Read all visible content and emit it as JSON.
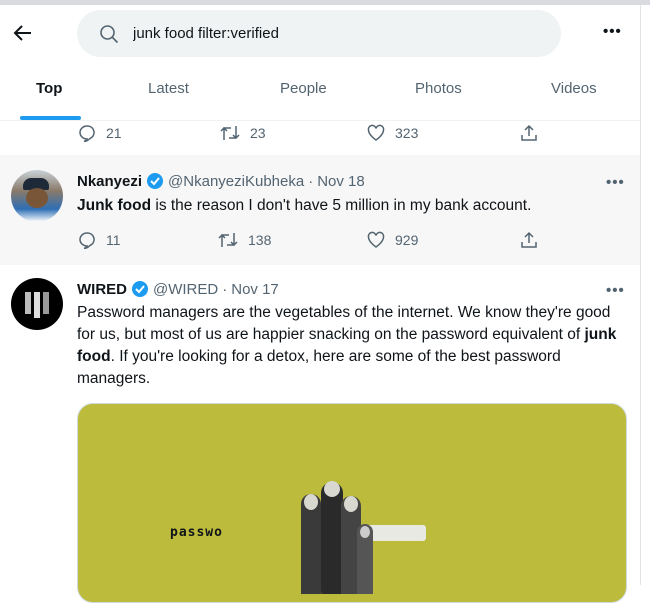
{
  "header": {
    "search_value": "junk food filter:verified",
    "tabs": [
      {
        "label": "Top",
        "active": true
      },
      {
        "label": "Latest"
      },
      {
        "label": "People"
      },
      {
        "label": "Photos"
      },
      {
        "label": "Videos"
      }
    ]
  },
  "prev_tweet": {
    "replies": "21",
    "retweets": "23",
    "likes": "323"
  },
  "tweets": [
    {
      "name": "Nkanyezi",
      "handle": "@NkanyeziKubheka",
      "date": "Nov 18",
      "bold": "Junk food",
      "text": " is the reason I don't have 5 million in my bank account.",
      "replies": "11",
      "retweets": "138",
      "likes": "929"
    },
    {
      "name": "WIRED",
      "handle": "@WIRED",
      "date": "Nov 17",
      "text1": "Password managers are the vegetables of the internet. We know they're good for us, but most of us are happier snacking on the password equivalent of ",
      "bold": "junk food",
      "text2": ". If you're looking for a detox, here are some of the best password managers.",
      "image_text": "passwo",
      "image_mask": "**"
    }
  ],
  "colors": {
    "accent": "#1d9bf0",
    "card_bg": "#bdbb3c",
    "highlight_bg": "#f7f7f7"
  }
}
